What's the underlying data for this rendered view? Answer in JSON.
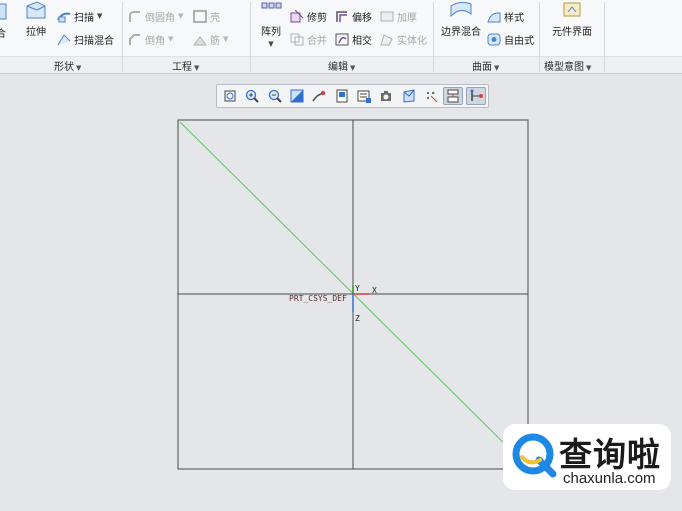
{
  "ribbon": {
    "shape_group": {
      "label": "形状",
      "partial_button": "合",
      "extrude": "拉伸",
      "sweep": "扫描",
      "swept_blend": "扫描混合"
    },
    "engineering_group": {
      "label": "工程",
      "round": "倒圆角",
      "chamfer": "倒角",
      "shell": "壳",
      "rib": "筋"
    },
    "pattern_button": "阵列",
    "editing_group": {
      "label": "编辑",
      "trim": "修剪",
      "offset": "偏移",
      "thicken": "加厚",
      "merge": "合并",
      "intersect": "相交",
      "solidify": "实体化"
    },
    "surfaces_group": {
      "label": "曲面",
      "boundary_blend": "边界混合",
      "style": "样式",
      "freestyle": "自由式"
    },
    "model_intent_group": {
      "label": "模型意图",
      "component_interface": "元件界面"
    }
  },
  "graphics_toolbar": {
    "tools": [
      {
        "icon": "refit-icon",
        "active": false
      },
      {
        "icon": "zoom-in-icon",
        "active": false
      },
      {
        "icon": "zoom-out-icon",
        "active": false
      },
      {
        "icon": "repaint-icon",
        "active": false
      },
      {
        "icon": "reorient-icon",
        "active": false
      },
      {
        "icon": "saved-orientations-icon",
        "active": false
      },
      {
        "icon": "view-manager-icon",
        "active": false
      },
      {
        "icon": "perspective-view-icon",
        "active": false
      },
      {
        "icon": "display-style-icon",
        "active": false
      },
      {
        "icon": "datum-display-icon",
        "active": false
      },
      {
        "icon": "annotation-display-icon",
        "active": true
      },
      {
        "icon": "spin-center-icon",
        "active": true
      }
    ]
  },
  "viewport": {
    "csys_label": "PRT_CSYS_DEF",
    "axis_x": "X",
    "axis_y": "Y",
    "axis_z": "Z",
    "colors": {
      "datum_plane": "#4a4a4a",
      "diagonal": "#5cc85c",
      "x_axis": "#d83a3a",
      "y_axis": "#2e8b2e",
      "z_axis": "#2f6fd6"
    }
  },
  "watermark": {
    "title": "查询啦",
    "subtitle": "chaxunla.com",
    "accent": "#1e88e5",
    "accent_yellow": "#f2c230"
  }
}
